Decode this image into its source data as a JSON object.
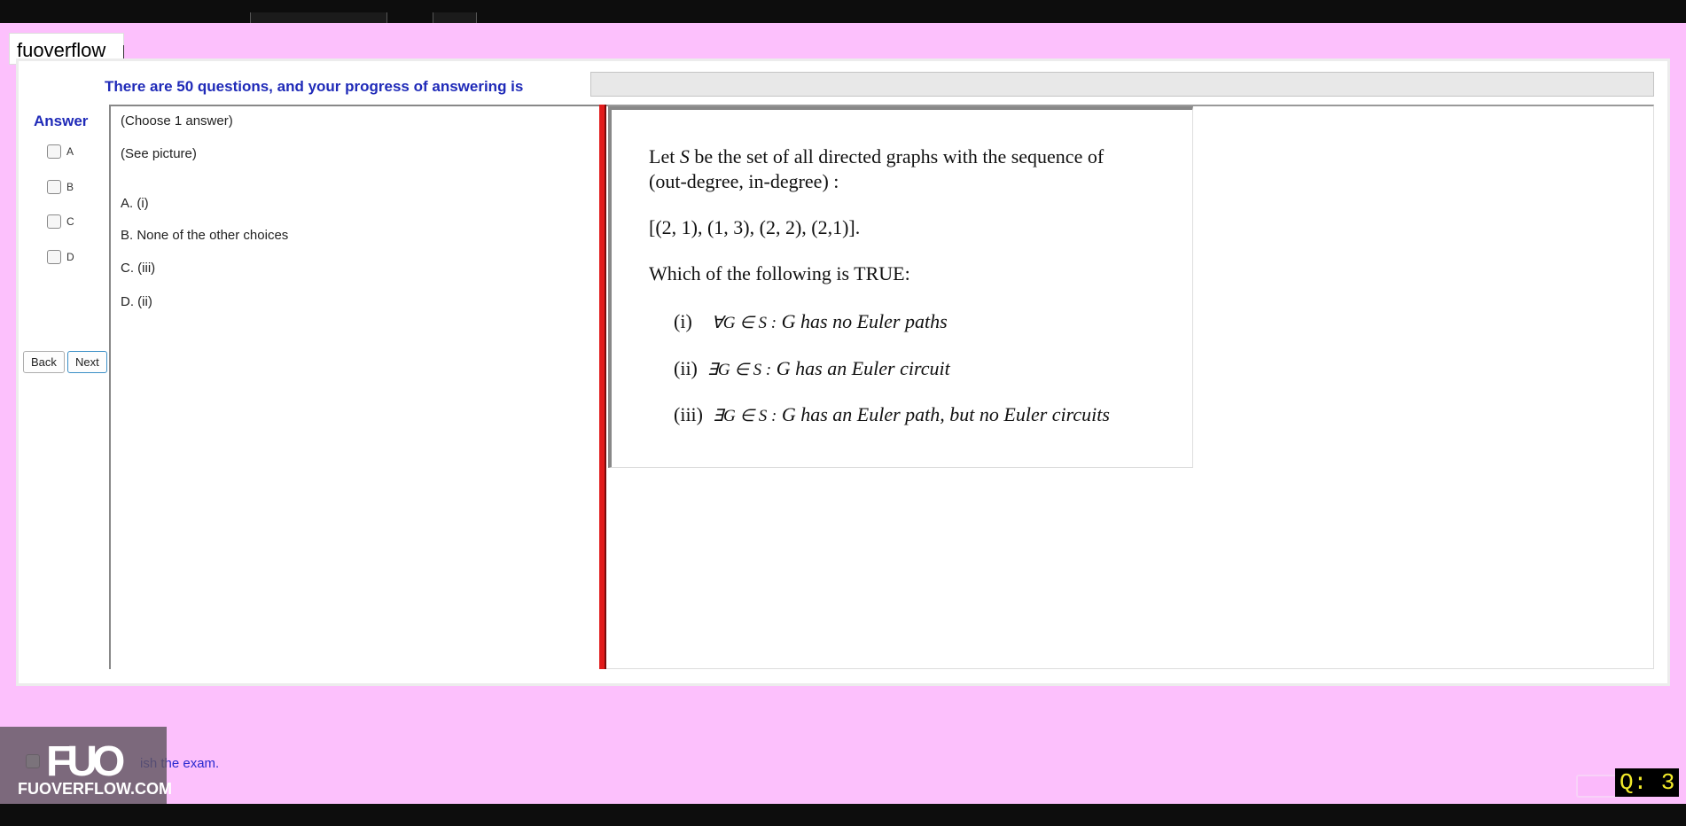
{
  "app": {
    "brand_input_value": "fuoverflow"
  },
  "progress": {
    "label": "There are 50 questions, and your progress of answering is",
    "fraction": 0
  },
  "answer": {
    "title": "Answer",
    "options": [
      {
        "label": "A",
        "checked": false
      },
      {
        "label": "B",
        "checked": false
      },
      {
        "label": "C",
        "checked": false
      },
      {
        "label": "D",
        "checked": false
      }
    ]
  },
  "navigation": {
    "back_label": "Back",
    "next_label": "Next"
  },
  "question": {
    "instruction": "(Choose 1 answer)",
    "prompt": "(See picture)",
    "choices": [
      "A.  (i)",
      "B.  None of the other choices",
      "C.  (iii)",
      "D.  (ii)"
    ]
  },
  "picture": {
    "line1_a": "Let ",
    "line1_var": "S",
    "line1_b": " be the set of all directed graphs with the sequence  of",
    "line2": "(out-degree, in-degree) :",
    "sequence": "[(2, 1), (1, 3), (2, 2), (2,1)].",
    "question": "Which of the following is  TRUE:",
    "statements": [
      {
        "num": "(i)",
        "quant": "∀G ∈ S :",
        "text": "G has no Euler paths"
      },
      {
        "num": "(ii)",
        "quant": "∃G ∈ S :",
        "text": "G has an Euler circuit"
      },
      {
        "num": "(iii)",
        "quant": "∃G ∈ S :",
        "text": "G has an Euler path, but no Euler circuits"
      }
    ]
  },
  "footer": {
    "finish_text": "ish the exam.",
    "finish_checked": false,
    "question_counter": "Q: 3"
  },
  "watermark": {
    "logo": "FUO",
    "site": "FUOVERFLOW.COM"
  },
  "colors": {
    "background": "#fcc0fc",
    "accent_blue": "#1f2ab8",
    "divider_red": "#e11b1b",
    "counter_yellow": "#f2ea2a"
  }
}
